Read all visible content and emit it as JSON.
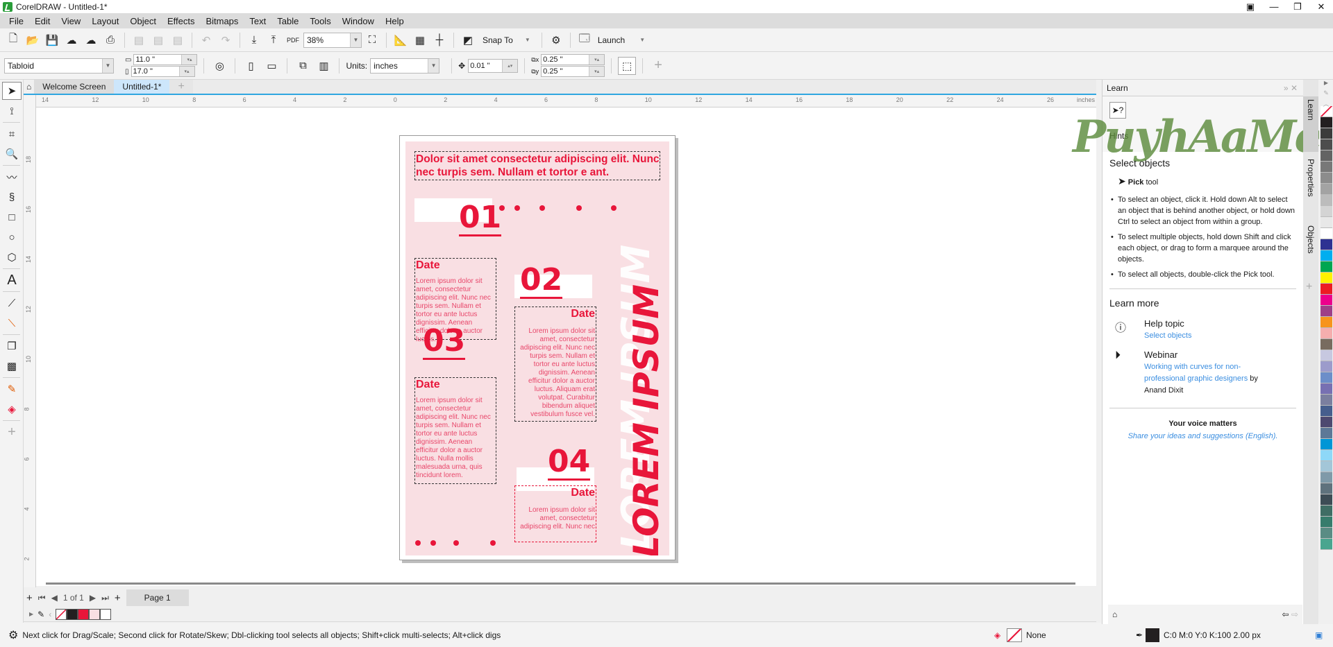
{
  "window": {
    "title": "CorelDRAW - Untitled-1*"
  },
  "menu": [
    "File",
    "Edit",
    "View",
    "Layout",
    "Object",
    "Effects",
    "Bitmaps",
    "Text",
    "Table",
    "Tools",
    "Window",
    "Help"
  ],
  "toolbar": {
    "zoom": "38%",
    "snap_to": "Snap To",
    "launch": "Launch"
  },
  "propertybar": {
    "page_size": "Tabloid",
    "width": "11.0 \"",
    "height": "17.0 \"",
    "units_label": "Units:",
    "units": "inches",
    "nudge": "0.01 \"",
    "dup_x": "0.25 \"",
    "dup_y": "0.25 \""
  },
  "tabs": [
    {
      "label": "Welcome Screen"
    },
    {
      "label": "Untitled-1*"
    }
  ],
  "ruler": {
    "h_ticks": [
      "14",
      "12",
      "10",
      "8",
      "6",
      "4",
      "2",
      "0",
      "2",
      "4",
      "6",
      "8",
      "10",
      "12",
      "14",
      "16",
      "18",
      "20",
      "22",
      "24",
      "26"
    ],
    "unit": "inches",
    "v_ticks": [
      "18",
      "16",
      "14",
      "12",
      "10",
      "8",
      "6",
      "4",
      "2"
    ]
  },
  "document": {
    "headline": "Dolor sit amet consectetur adipiscing elit. Nunc nec turpis sem. Nullam et tortor e ant.",
    "numbers": [
      "01",
      "02",
      "03",
      "04"
    ],
    "date_label": "Date",
    "body1": "Lorem ipsum dolor sit amet, consectetur adipiscing elit. Nunc nec turpis sem. Nullam et tortor eu ante luctus dignissim. Aenean efficitur dolor a auctor luctus.",
    "body2": "Lorem ipsum dolor sit amet, consectetur adipiscing elit. Nunc nec turpis sem. Nullam et tortor eu ante luctus dignissim. Aenean efficitur dolor a auctor luctus. Aliquam erat volutpat. Curabitur bibendum aliquet vestibulum fusce vel.",
    "body3": "Lorem ipsum dolor sit amet, consectetur adipiscing elit. Nunc nec turpis sem. Nullam et tortor eu ante luctus dignissim. Aenean efficitur dolor a auctor luctus. Nulla mollis malesuada urna, quis tincidunt lorem.",
    "body4": "Lorem ipsum dolor sit amet, consectetur adipiscing elit. Nunc nec",
    "vertical_text": "LOREM IPSUM",
    "accent": "#e8163a",
    "bg": "#f9dfe3"
  },
  "pagenav": {
    "count": "1 of 1",
    "page_tab": "Page 1"
  },
  "status": {
    "hint": "Next click for Drag/Scale; Second click for Rotate/Skew; Dbl-clicking tool selects all objects; Shift+click multi-selects; Alt+click digs",
    "fill": "None",
    "outline": "C:0 M:0 Y:0 K:100  2.00 px"
  },
  "learn": {
    "title": "Learn",
    "hints": "Hints",
    "section": "Select objects",
    "tool_bold": "Pick",
    "tool_rest": " tool",
    "bullets": [
      "To select an object, click it. Hold down Alt to select an object that is behind another object, or hold down Ctrl to select an object from within a group.",
      "To select multiple objects, hold down Shift and click each object, or drag to form a marquee around the objects.",
      "To select all objects, double-click the Pick tool."
    ],
    "learn_more": "Learn more",
    "help_topic": "Help topic",
    "help_link": "Select objects",
    "webinar": "Webinar",
    "webinar_link": "Working with curves for non-professional graphic designers",
    "webinar_by": " by Anand Dixit",
    "voice": "Your voice matters",
    "voice_link": "Share your ideas and suggestions (English)."
  },
  "docker_tabs": [
    "Learn",
    "Properties",
    "Objects"
  ],
  "watermark": "PuyhAaMe",
  "palette": [
    "#ffffff",
    "#231f20",
    "#3b3b3b",
    "#4d4d4d",
    "#636363",
    "#787878",
    "#8c8c8c",
    "#a3a3a3",
    "#bcbcbc",
    "#d4d4d4",
    "#e8e8e8",
    "#ffffff",
    "#2e3192",
    "#00aeef",
    "#00a651",
    "#fff200",
    "#ed1c24",
    "#ec008c",
    "#9e3f88",
    "#f7941d",
    "#f5aeae",
    "#786b5f",
    "#c7c8e0",
    "#9c9bcb",
    "#6c8ec9",
    "#7770b2",
    "#7b7f9f",
    "#465e8d",
    "#4d4970",
    "#5d7897",
    "#0096d6",
    "#8ed8f8",
    "#a3c6d8",
    "#7f9aa9",
    "#5f727d",
    "#3d4c55",
    "#3f6d64",
    "#377c6c",
    "#5a8c84",
    "#4aa58f"
  ],
  "doc_palette": [
    "none",
    "#231f20",
    "#e8163a",
    "#f9dfe3",
    "#ffffff"
  ]
}
